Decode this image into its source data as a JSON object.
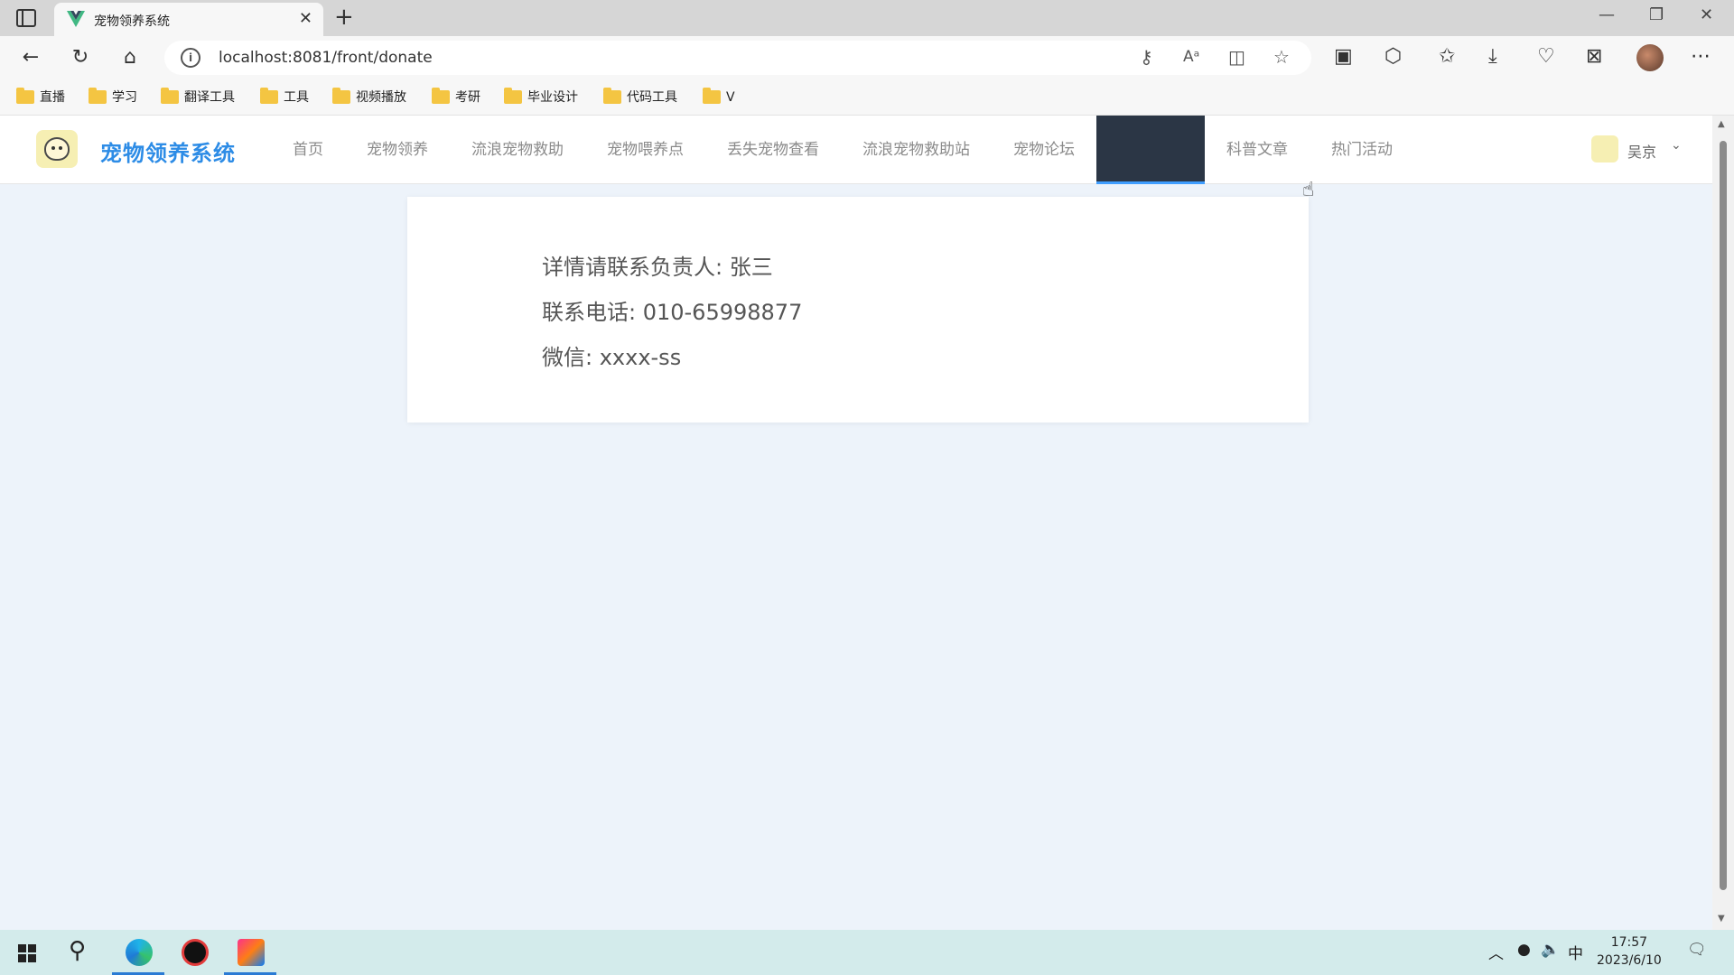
{
  "browser": {
    "tab_title": "宠物领养系统",
    "tab_close": "✕",
    "new_tab": "+",
    "url": "localhost:8081/front/donate",
    "info_icon": "i",
    "window": {
      "minimize": "—",
      "restore": "❐",
      "close": "✕"
    },
    "nav": {
      "back": "←",
      "reload": "↻",
      "home": "⌂"
    },
    "bookmarks": [
      "直播",
      "学习",
      "翻译工具",
      "工具",
      "视频播放",
      "考研",
      "毕业设计",
      "代码工具",
      "V"
    ],
    "toolbar_icons": [
      "key-icon",
      "read-aloud-icon",
      "split-screen-icon",
      "favorite-star-icon",
      "collections-icon",
      "extensions-icon",
      "favorites-icon",
      "downloads-icon",
      "browser-essentials-icon",
      "screenshot-icon",
      "profile-avatar",
      "more-icon"
    ]
  },
  "site": {
    "title": "宠物领养系统",
    "menu": [
      "首页",
      "宠物领养",
      "流浪宠物救助",
      "宠物喂养点",
      "丢失宠物查看",
      "流浪宠物救助站",
      "宠物论坛",
      "",
      "科普文章",
      "热门活动"
    ],
    "active_index": 7,
    "user_name": "吴京",
    "caret": "⌄"
  },
  "donate": {
    "contact_person": "详情请联系负责人: 张三",
    "phone": "联系电话: 010-65998877",
    "wechat": "微信: xxxx-ss"
  },
  "taskbar": {
    "time": "17:57",
    "date": "2023/6/10",
    "ime": "中",
    "apps": [
      "start-icon",
      "search-icon",
      "edge-icon",
      "media-app-icon",
      "intellij-icon"
    ]
  },
  "colors": {
    "brand": "#2d8ce6",
    "active_menu_bg": "#2b3645",
    "active_menu_underline": "#409eff",
    "page_bg": "#edf3fa"
  }
}
